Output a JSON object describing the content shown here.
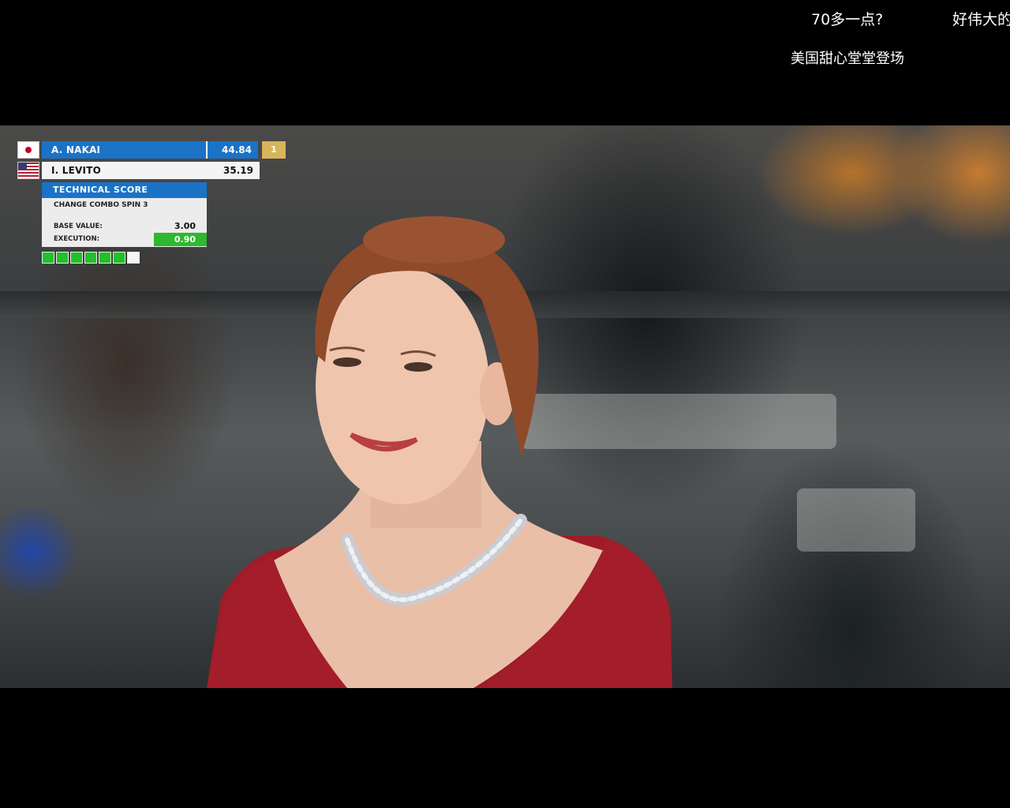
{
  "danmaku": {
    "comments": [
      {
        "text": "70多一点?"
      },
      {
        "text": "好伟大的"
      },
      {
        "text": "美国甜心堂堂登场"
      }
    ]
  },
  "scoreboard": {
    "rows": [
      {
        "flag": "flag-japan-icon",
        "name": "A. NAKAI",
        "score": "44.84",
        "rank": "1"
      },
      {
        "flag": "flag-usa-icon",
        "name": "I. LEVITO",
        "score": "35.19"
      }
    ],
    "technical": {
      "header": "TECHNICAL SCORE",
      "element": "CHANGE COMBO SPIN 3",
      "base_value_label": "BASE VALUE:",
      "base_value": "3.00",
      "execution_label": "EXECUTION:",
      "execution": "0.90"
    },
    "judges": {
      "positive": 6,
      "total": 7
    },
    "colors": {
      "primary": "#1a73c7",
      "rank": "#d8b45a",
      "positive": "#2eb82e"
    }
  }
}
